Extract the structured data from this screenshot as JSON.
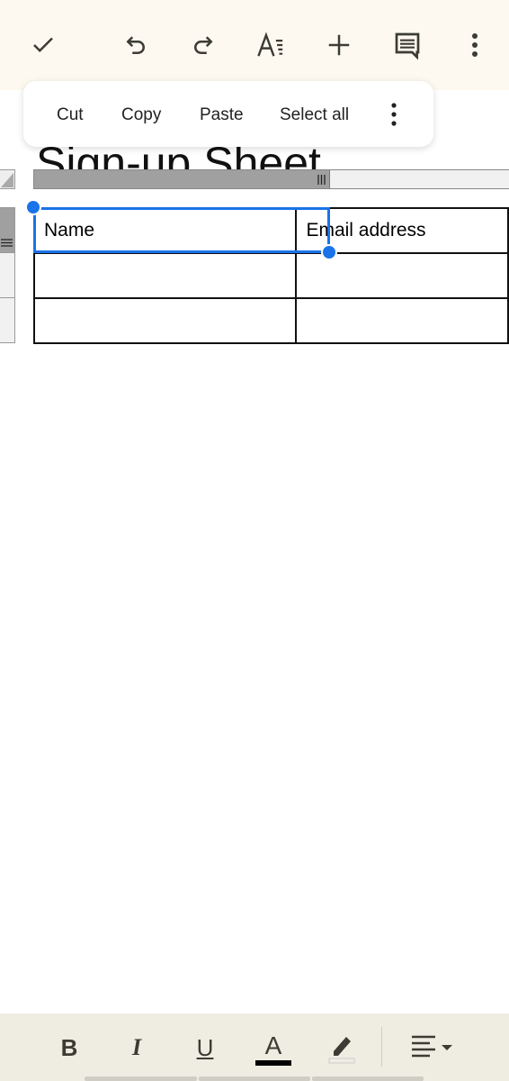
{
  "toolbar": {
    "icons": [
      "check-icon",
      "undo-icon",
      "redo-icon",
      "text-format-icon",
      "insert-icon",
      "comment-icon",
      "more-vert-icon"
    ]
  },
  "context_menu": {
    "items": [
      "Cut",
      "Copy",
      "Paste",
      "Select all"
    ]
  },
  "document": {
    "title": "Sign-up Sheet",
    "table": {
      "rows": [
        [
          "Name",
          "Email address"
        ],
        [
          "",
          ""
        ],
        [
          "",
          ""
        ]
      ]
    }
  },
  "format_bar": {
    "bold": "B",
    "italic": "I",
    "underline": "U",
    "text_color": "A",
    "text_color_value": "#000000"
  },
  "colors": {
    "accent": "#1a73e8",
    "topbar": "#fdf9f0",
    "bottombar": "#efede2"
  }
}
